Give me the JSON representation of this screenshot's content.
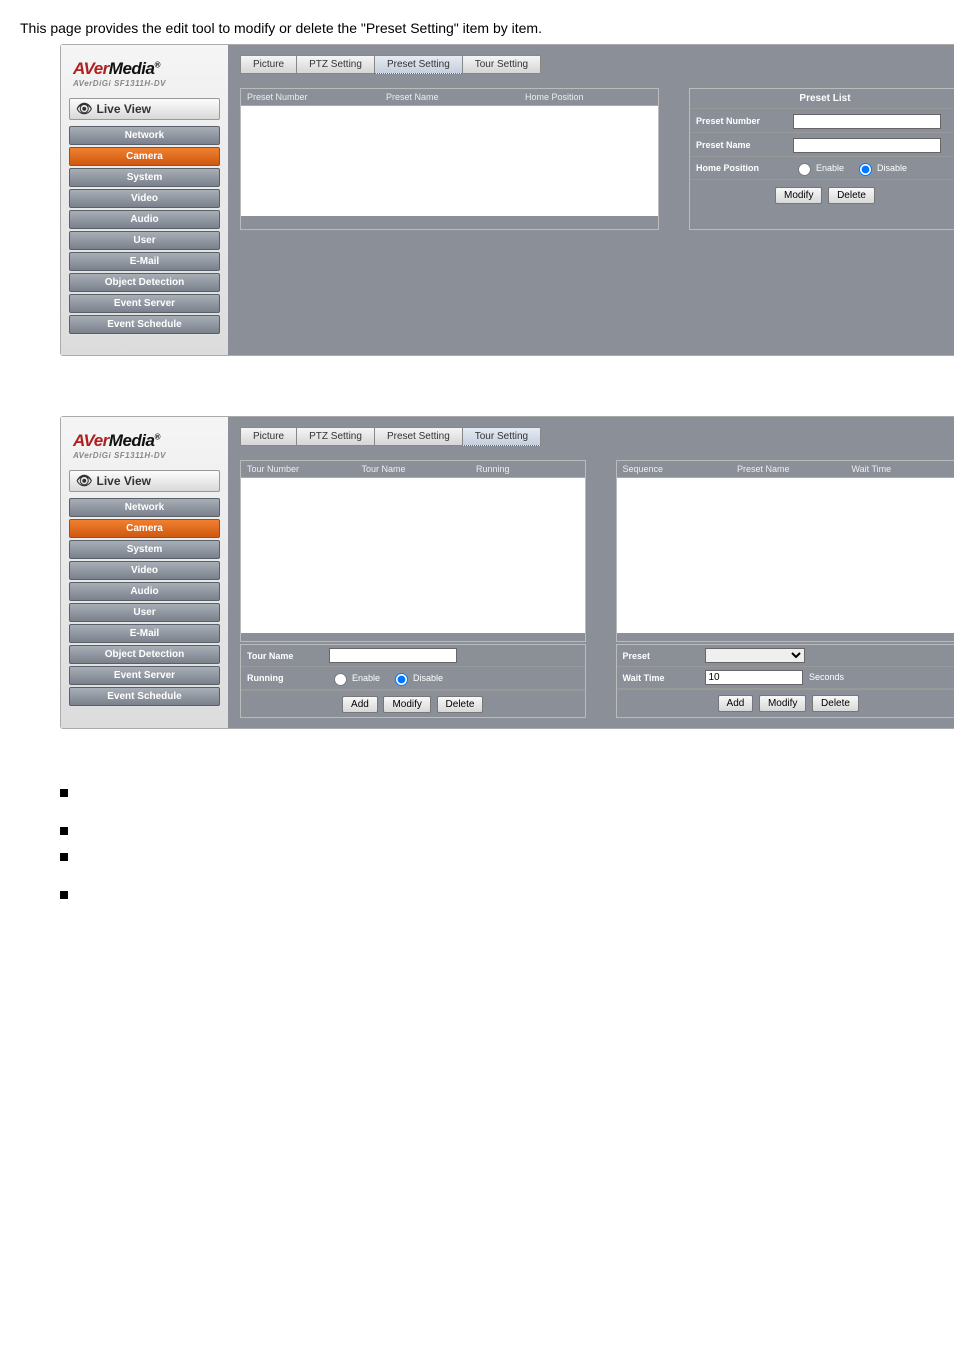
{
  "intro": "This page provides the edit tool to modify or delete the \"Preset Setting\" item by item.",
  "logo": {
    "brand1": "AVer",
    "brand2": "Media",
    "sub": "AVerDiGi SF1311H-DV"
  },
  "liveview": "Live View",
  "nav": [
    "Network",
    "Camera",
    "System",
    "Video",
    "Audio",
    "User",
    "E-Mail",
    "Object Detection",
    "Event Server",
    "Event Schedule"
  ],
  "tabs": [
    "Picture",
    "PTZ Setting",
    "Preset Setting",
    "Tour Setting"
  ],
  "preset_panel": {
    "left_headers": [
      "Preset Number",
      "Preset Name",
      "Home Position"
    ],
    "title": "Preset List",
    "fields": {
      "num": "Preset Number",
      "name": "Preset Name",
      "home": "Home Position"
    },
    "enable": "Enable",
    "disable": "Disable",
    "modify": "Modify",
    "delete": "Delete"
  },
  "tour_panel": {
    "left_headers": [
      "Tour Number",
      "Tour Name",
      "Running"
    ],
    "right_headers": [
      "Sequence",
      "Preset Name",
      "Wait Time"
    ],
    "tourname": "Tour Name",
    "running": "Running",
    "enable": "Enable",
    "disable": "Disable",
    "preset": "Preset",
    "waittime": "Wait Time",
    "waitvalue": "10",
    "seconds": "Seconds",
    "add": "Add",
    "modify": "Modify",
    "delete": "Delete"
  }
}
